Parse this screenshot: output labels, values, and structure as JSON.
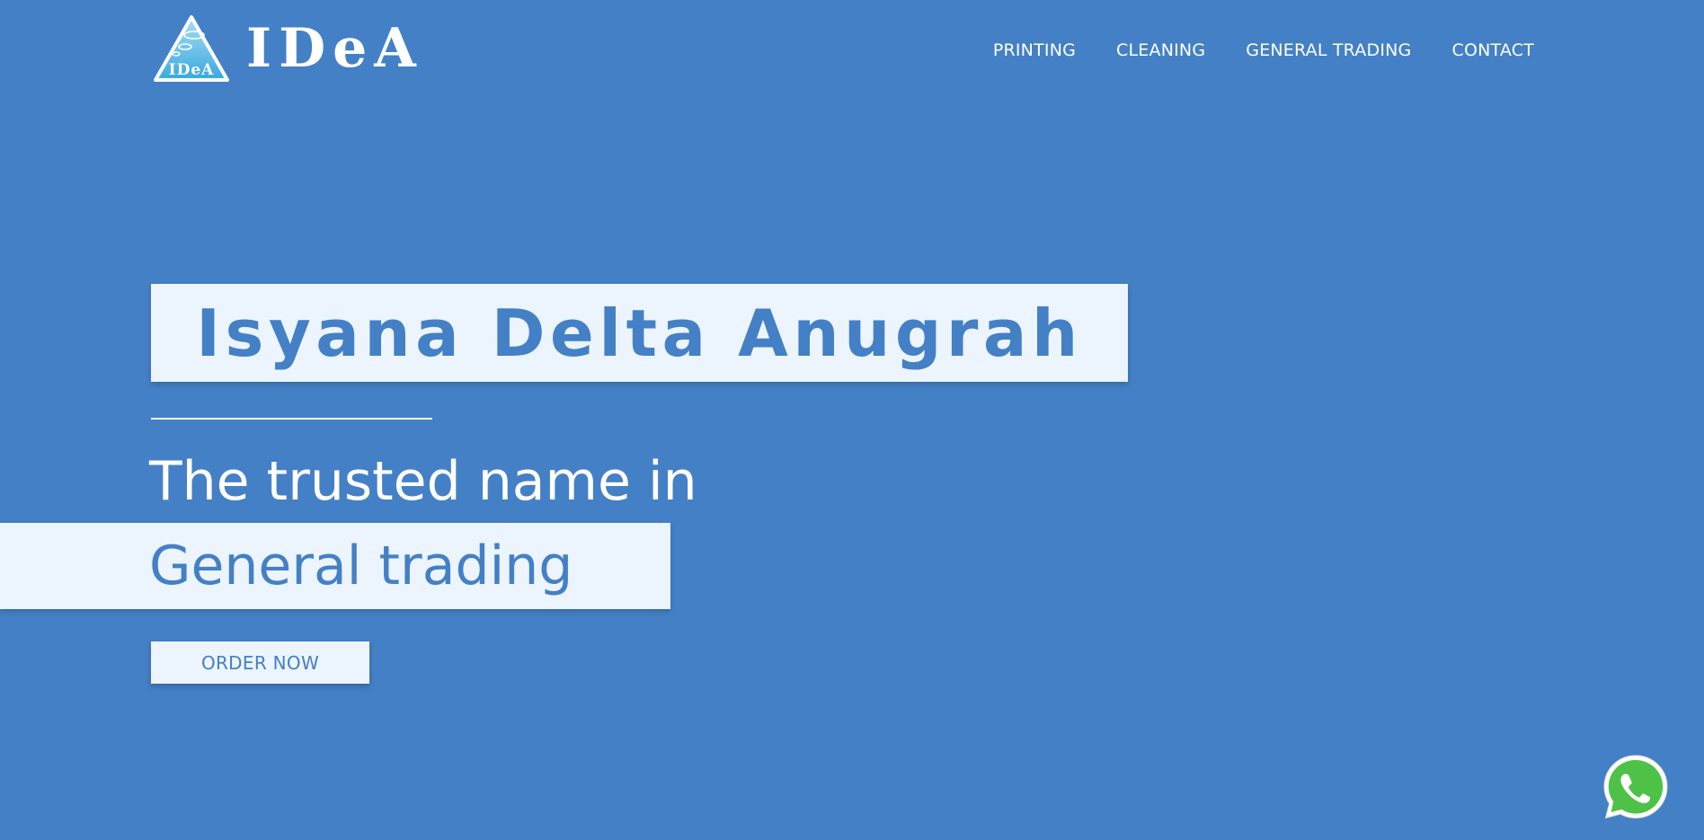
{
  "header": {
    "logo_wordmark": "IDeA",
    "logo_mark_text": "IDeA",
    "nav": [
      {
        "label": "PRINTING"
      },
      {
        "label": "CLEANING"
      },
      {
        "label": "GENERAL TRADING"
      },
      {
        "label": "CONTACT"
      }
    ]
  },
  "hero": {
    "title": "Isyana Delta Anugrah",
    "subtitle": "The trusted name in",
    "highlight": "General trading",
    "cta_label": "ORDER NOW"
  },
  "floating": {
    "icon": "whatsapp-icon"
  },
  "colors": {
    "background": "#4480c6",
    "panel": "#ecf4fd",
    "accent_text": "#4480c6",
    "whatsapp_green": "#4dc247"
  }
}
